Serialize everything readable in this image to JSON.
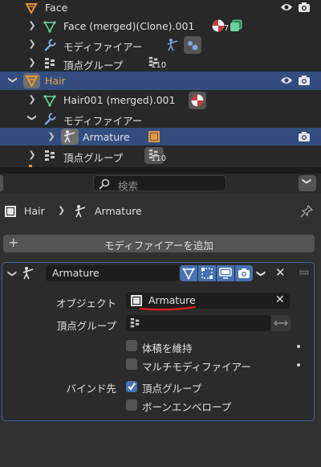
{
  "outliner": {
    "rows": [
      {
        "label": "Face"
      },
      {
        "label": "Face (merged)(Clone).001",
        "badge": "7"
      },
      {
        "label": "モディファイアー"
      },
      {
        "label": "頂点グループ",
        "badge": "110"
      },
      {
        "label": "Hair"
      },
      {
        "label": "Hair001 (merged).001"
      },
      {
        "label": "モディファイアー"
      },
      {
        "label": "Armature"
      },
      {
        "label": "頂点グループ",
        "badge": "110"
      }
    ]
  },
  "properties": {
    "search_placeholder": "検索",
    "breadcrumb": {
      "object": "Hair",
      "modifier": "Armature"
    },
    "add_modifier_label": "モディファイアーを追加",
    "modifier": {
      "name": "Armature",
      "object_label": "オブジェクト",
      "object_value": "Armature",
      "vertex_group_label": "頂点グループ",
      "preserve_volume_label": "体積を維持",
      "multi_modifier_label": "マルチモディファイアー",
      "bind_to_label": "バインド先",
      "bind_vertex_groups_label": "頂点グループ",
      "bind_bone_envelopes_label": "ボーンエンベロープ",
      "preserve_volume": false,
      "multi_modifier": false,
      "bind_vertex_groups": true,
      "bind_bone_envelopes": false
    }
  },
  "colors": {
    "background": "#303030",
    "selected_row": "#334d80",
    "active_row": "#1c2a44",
    "object_orange": "#e8943a",
    "mesh_green": "#6bd19b",
    "wrench_blue": "#7ea4e0",
    "underline_red": "#e02020",
    "checkbox_on": "#4772b3"
  }
}
